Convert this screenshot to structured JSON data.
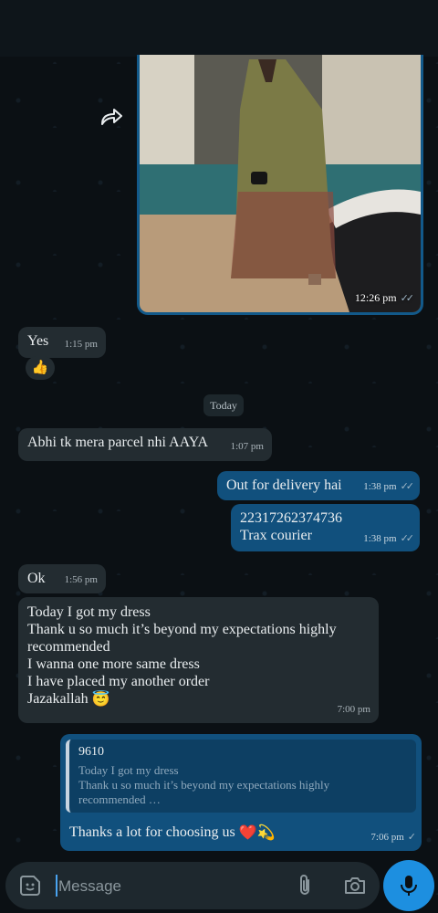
{
  "forwarded_photo": {
    "time": "12:26 pm",
    "ticks": "✓✓"
  },
  "messages": [
    {
      "id": "yes",
      "text": "Yes",
      "time": "1:15 pm",
      "reaction": "👍"
    },
    {
      "id": "date",
      "text": "Today"
    },
    {
      "id": "abhi",
      "text": "Abhi tk mera parcel nhi AAYA",
      "time": "1:07 pm"
    },
    {
      "id": "out-delivery",
      "text": "Out for delivery hai",
      "time": "1:38 pm",
      "ticks": "✓✓"
    },
    {
      "id": "tracking",
      "line1": "22317262374736",
      "line2": "Trax courier",
      "time": "1:38 pm",
      "ticks": "✓✓"
    },
    {
      "id": "ok",
      "text": "Ok",
      "time": "1:56 pm"
    },
    {
      "id": "long",
      "lines": [
        "Today I got my dress",
        "Thank u so much it’s beyond my expectations highly",
        "recommended",
        "I wanna one more same dress",
        "I have placed my another order",
        "Jazakallah"
      ],
      "emoji": "😇",
      "time": "7:00 pm"
    },
    {
      "id": "reply",
      "quote_title": "9610",
      "quote_lines": [
        "Today I got my dress",
        "Thank u so much it’s beyond my expectations highly",
        "recommended …"
      ],
      "text": "Thanks a lot for choosing us",
      "emoji": "❤️💫",
      "time": "7:06 pm",
      "ticks": "✓"
    }
  ],
  "input": {
    "placeholder": "Message"
  },
  "icons": [
    "forward-icon",
    "sticker-icon",
    "attach-icon",
    "camera-icon",
    "mic-icon"
  ],
  "colors": {
    "incoming": "#232c31",
    "outgoing": "#11507d",
    "accent": "#1d8fe0"
  }
}
